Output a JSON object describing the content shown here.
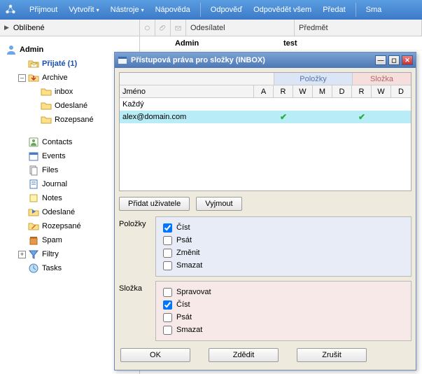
{
  "menubar": {
    "accept": "Přijmout",
    "create": "Vytvořit",
    "tools": "Nástroje",
    "help": "Nápověda",
    "reply": "Odpověď",
    "reply_all": "Odpovědět všem",
    "forward": "Předat",
    "delete": "Sma"
  },
  "toolbar2": {
    "favorites": "Oblíbené",
    "sender": "Odesílatel",
    "subject": "Předmět"
  },
  "message_row": {
    "sender": "Admin",
    "subject": "test"
  },
  "tree": {
    "root": "Admin",
    "inbox": "Přijaté (1)",
    "archive": "Archive",
    "archive_inbox": "inbox",
    "archive_sent": "Odeslané",
    "archive_drafts": "Rozepsané",
    "contacts": "Contacts",
    "events": "Events",
    "files": "Files",
    "journal": "Journal",
    "notes": "Notes",
    "sent": "Odeslané",
    "drafts": "Rozepsané",
    "spam": "Spam",
    "filters": "Filtry",
    "tasks": "Tasks"
  },
  "dialog": {
    "title": "Přístupová práva pro složky (INBOX)",
    "grid": {
      "group_items": "Položky",
      "group_folder": "Složka",
      "col_name": "Jméno",
      "col_a": "A",
      "col_r": "R",
      "col_w": "W",
      "col_m": "M",
      "col_d": "D",
      "rows": [
        {
          "name": "Každý",
          "a": false,
          "ir": false,
          "iw": false,
          "im": false,
          "id": false,
          "fr": false,
          "fw": false,
          "fd": false
        },
        {
          "name": "alex@domain.com",
          "a": false,
          "ir": true,
          "iw": false,
          "im": false,
          "id": false,
          "fr": true,
          "fw": false,
          "fd": false
        }
      ]
    },
    "add_user": "Přidat uživatele",
    "remove": "Vyjmout",
    "items_label": "Položky",
    "folder_label": "Složka",
    "perm_read": "Číst",
    "perm_write": "Psát",
    "perm_modify": "Změnit",
    "perm_delete": "Smazat",
    "perm_admin": "Spravovat",
    "items_read_checked": true,
    "folder_read_checked": true,
    "ok": "OK",
    "inherit": "Zdědit",
    "cancel": "Zrušit"
  }
}
